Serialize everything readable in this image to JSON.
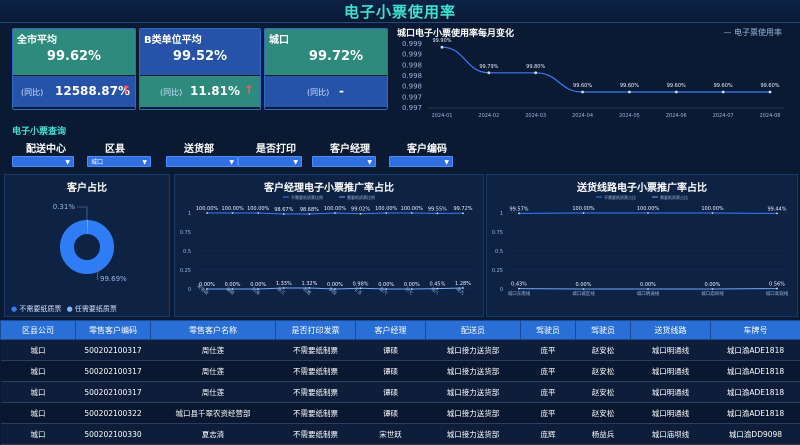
{
  "header": {
    "title": "电子小票使用率"
  },
  "kpis": [
    {
      "label": "全市平均",
      "value": "99.62%",
      "sub_label": "(同比)",
      "sub_value": "12588.87%",
      "arrow": "↑"
    },
    {
      "label": "B类单位平均",
      "value": "99.52%",
      "sub_label": "(同比)",
      "sub_value": "11.81%",
      "arrow": "↑"
    },
    {
      "label": "城口",
      "value": "99.72%",
      "sub_label": "(同比)",
      "sub_value": "-",
      "arrow": ""
    }
  ],
  "colors": {
    "accent": "#3fe0d0",
    "kpi_green": "#2d8a7c",
    "kpi_blue": "#2653a8",
    "select_blue": "#2f6fe0",
    "line_blue": "#3a7bff",
    "donut_blue": "#2f7df6"
  },
  "monthly_chart": {
    "title": "城口电子小票使用率每月变化",
    "legend": "电子票使用率",
    "y_ticks": [
      "0.999",
      "0.999",
      "0.998",
      "0.998",
      "0.998",
      "0.997",
      "0.997"
    ]
  },
  "query": {
    "section_title": "电子小票查询",
    "filters": [
      {
        "label": "配送中心",
        "value": ""
      },
      {
        "label": "区县",
        "value": "城口"
      },
      {
        "label": "送货部",
        "value": ""
      },
      {
        "label": "是否打印",
        "value": ""
      },
      {
        "label": "客户经理",
        "value": ""
      },
      {
        "label": "客户编码",
        "value": ""
      }
    ]
  },
  "customer_share": {
    "title": "客户占比",
    "legend": [
      "不需要纸质票",
      "任需要纸质票"
    ]
  },
  "manager_chart": {
    "title": "客户经理电子小票推广率占比",
    "legend": [
      "不需要纸质票比例",
      "需要纸质票比例"
    ],
    "y_ticks": [
      "1",
      "0.75",
      "0.5",
      "0.25",
      "0"
    ]
  },
  "route_chart": {
    "title": "送货线路电子小票推广率占比",
    "legend": [
      "不需要纸质票占比",
      "需要纸质票占比"
    ],
    "y_ticks": [
      "1",
      "0.75",
      "0.5",
      "0.25",
      "0"
    ]
  },
  "chart_data": [
    {
      "type": "line",
      "title": "城口电子小票使用率每月变化",
      "x": [
        "2024-01",
        "2024-02",
        "2024-03",
        "2024-04",
        "2024-05",
        "2024-06",
        "2024-07",
        "2024-08"
      ],
      "series": [
        {
          "name": "电子票使用率",
          "values": [
            0.9989,
            0.9981,
            0.9981,
            0.9975,
            0.9975,
            0.9975,
            0.9975,
            0.9975
          ]
        }
      ],
      "labels": [
        "99.90%",
        "99.79%",
        "99.80%",
        "99.60%",
        "99.60%",
        "99.60%",
        "99.60%",
        "99.60%"
      ],
      "ylim": [
        0.997,
        0.999
      ]
    },
    {
      "type": "pie",
      "title": "客户占比",
      "categories": [
        "任需要纸质票",
        "不需要纸质票"
      ],
      "values": [
        0.31,
        99.69
      ],
      "labels": [
        "0.31%",
        "99.69%"
      ]
    },
    {
      "type": "line",
      "title": "客户经理电子小票推广率占比",
      "categories": [
        "宋世跃",
        "谭硕",
        "刘涛",
        "张三",
        "何宽",
        "李四",
        "王五",
        "赵六",
        "孙七",
        "周八",
        "吴九"
      ],
      "series": [
        {
          "name": "不需要纸质票比例",
          "values": [
            1.0,
            1.0,
            1.0,
            0.9867,
            0.9868,
            1.0,
            0.9902,
            1.0,
            1.0,
            0.9955,
            0.9972
          ]
        },
        {
          "name": "需要纸质票比例",
          "values": [
            0.0,
            0.0,
            0.0,
            0.0133,
            0.0132,
            0.0,
            0.0098,
            0.0,
            0.0,
            0.0045,
            0.0128
          ]
        }
      ],
      "top_labels": [
        "100.00%",
        "100.00%",
        "100.00%",
        "98.67%",
        "98.68%",
        "100.00%",
        "99.02%",
        "100.00%",
        "100.00%",
        "99.55%",
        "99.72%"
      ],
      "bottom_labels": [
        "0.00%",
        "0.00%",
        "0.00%",
        "1.33%",
        "1.32%",
        "0.00%",
        "0.98%",
        "0.00%",
        "0.00%",
        "0.45%",
        "1.28%"
      ],
      "ylim": [
        0,
        1
      ]
    },
    {
      "type": "line",
      "title": "送货线路电子小票推广率占比",
      "categories": [
        "城口东南线",
        "城口城区线",
        "城口明通线",
        "城口庙坝线",
        "城口高观线"
      ],
      "series": [
        {
          "name": "不需要纸质票占比",
          "values": [
            0.9957,
            1.0,
            1.0,
            1.0,
            0.9944
          ]
        },
        {
          "name": "需要纸质票占比",
          "values": [
            0.0043,
            0.0,
            0.0,
            0.0,
            0.0056
          ]
        }
      ],
      "top_labels": [
        "99.57%",
        "100.00%",
        "100.00%",
        "100.00%",
        "99.44%"
      ],
      "bottom_labels": [
        "0.43%",
        "0.00%",
        "0.00%",
        "0.00%",
        "0.56%"
      ],
      "ylim": [
        0,
        1
      ]
    }
  ],
  "table": {
    "columns": [
      "区县公司",
      "零售客户编码",
      "零售客户名称",
      "是否打印发票",
      "客户经理",
      "配送员",
      "驾驶员",
      "驾驶员",
      "送货线路",
      "车牌号"
    ],
    "rows": [
      [
        "城口",
        "500202100317",
        "周仕莲",
        "不需要纸制票",
        "谭硕",
        "城口接力送货部",
        "庞平",
        "赵安松",
        "城口明通线",
        "城口渝ADE1818"
      ],
      [
        "城口",
        "500202100317",
        "周仕莲",
        "不需要纸制票",
        "谭硕",
        "城口接力送货部",
        "庞平",
        "赵安松",
        "城口明通线",
        "城口渝ADE1818"
      ],
      [
        "城口",
        "500202100317",
        "周仕莲",
        "不需要纸制票",
        "谭硕",
        "城口接力送货部",
        "庞平",
        "赵安松",
        "城口明通线",
        "城口渝ADE1818"
      ],
      [
        "城口",
        "500202100322",
        "城口县千翠农资经营部",
        "不需要纸制票",
        "谭硕",
        "城口接力送货部",
        "庞平",
        "赵安松",
        "城口明通线",
        "城口渝ADE1818"
      ],
      [
        "城口",
        "500202100330",
        "夏志清",
        "不需要纸制票",
        "宋世跃",
        "城口接力送货部",
        "庞辉",
        "杨益兵",
        "城口庙坝线",
        "城口渝DD9098"
      ]
    ]
  }
}
